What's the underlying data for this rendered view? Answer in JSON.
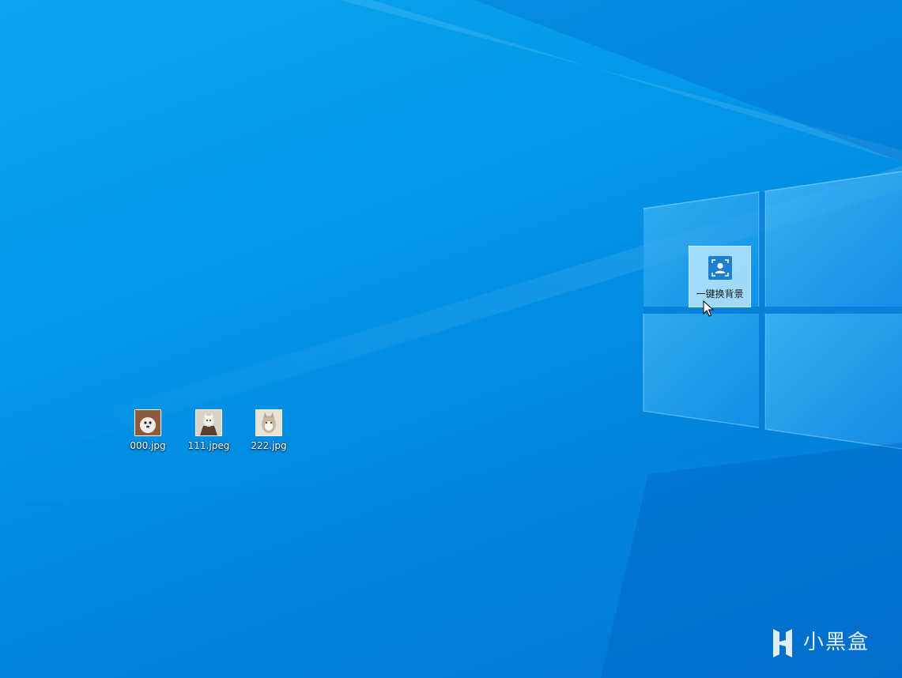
{
  "desktop": {
    "background_color": "#0397e8",
    "icons": [
      {
        "label": "000.jpg",
        "thumb_colors": [
          "#8c5a3c",
          "#f1ece6"
        ]
      },
      {
        "label": "111.jpeg",
        "thumb_colors": [
          "#d8d2c6",
          "#5a3f2f"
        ]
      },
      {
        "label": "222.jpg",
        "thumb_colors": [
          "#e6e2da",
          "#c8b8a0"
        ]
      }
    ]
  },
  "app_shortcut": {
    "label": "一键换背景",
    "icon": "user-frame-icon",
    "accent": "#1f7fcf",
    "selected": true
  },
  "cursor": {
    "icon": "arrow-cursor-icon"
  },
  "watermark": {
    "text": "小黑盒",
    "icon": "xiaoheihe-logo"
  }
}
